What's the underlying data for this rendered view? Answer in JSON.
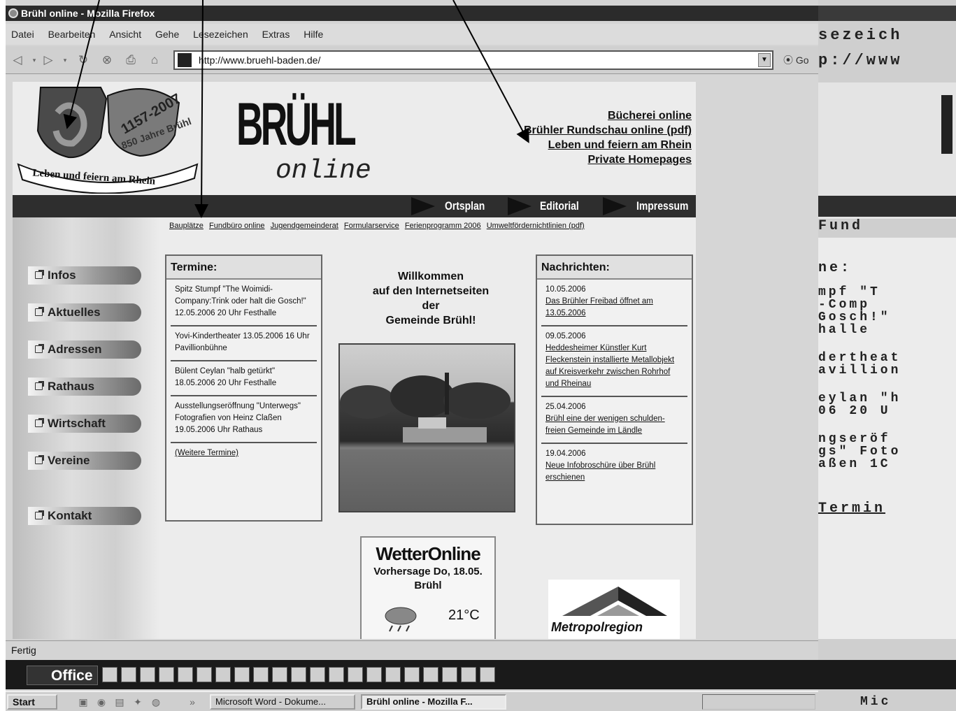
{
  "window": {
    "title": "Brühl online - Mozilla Firefox"
  },
  "menu": [
    "Datei",
    "Bearbeiten",
    "Ansicht",
    "Gehe",
    "Lesezeichen",
    "Extras",
    "Hilfe"
  ],
  "toolbar": {
    "url": "http://www.bruehl-baden.de/",
    "go_label": "Go"
  },
  "page": {
    "logo_motto": "Leben und feiern am Rhein",
    "logo_years": "1157-2007",
    "logo_jubilee": "850 Jahre Brühl",
    "brand_main": "BRÜHL",
    "brand_sub": "online",
    "top_links": [
      "Bücherei online",
      "Brühler Rundschau online (pdf)",
      "Leben und feiern am Rhein",
      "Private Homepages"
    ],
    "nav": [
      "Ortsplan",
      "Editorial",
      "Impressum"
    ],
    "sub_links": [
      "Bauplätze",
      "Fundbüro online",
      "Jugendgemeinderat",
      "Formularservice",
      "Ferienprogramm 2006",
      "Umweltfördernichtlinien (pdf)"
    ],
    "left_nav": [
      "Infos",
      "Aktuelles",
      "Adressen",
      "Rathaus",
      "Wirtschaft",
      "Vereine",
      "Kontakt"
    ],
    "termine": {
      "title": "Termine:",
      "items": [
        "Spitz Stumpf \"The Woimidi-Company:Trink oder halt die Gosch!\" 12.05.2006 20 Uhr Festhalle",
        "Yovi-Kindertheater 13.05.2006 16 Uhr Pavillionbühne",
        "Bülent Ceylan \"halb getürkt\" 18.05.2006 20 Uhr Festhalle",
        "Ausstellungseröffnung \"Unterwegs\" Fotografien von Heinz Claßen 19.05.2006 Uhr Rathaus"
      ],
      "more": "(Weitere Termine)"
    },
    "welcome": [
      "Willkommen",
      "auf den Internetseiten",
      "der",
      "Gemeinde Brühl!"
    ],
    "nachrichten": {
      "title": "Nachrichten:",
      "items": [
        {
          "date": "10.05.2006",
          "text": "Das Brühler Freibad öffnet am 13.05.2006"
        },
        {
          "date": "09.05.2006",
          "text": "Heddesheimer Künstler Kurt Fleckenstein installierte Metallobjekt auf Kreisverkehr zwischen Rohrhof und Rheinau"
        },
        {
          "date": "25.04.2006",
          "text": "Brühl eine der wenigen schulden-freien Gemeinde im Ländle"
        },
        {
          "date": "19.04.2006",
          "text": "Neue Infobroschüre über Brühl erschienen"
        }
      ]
    },
    "weather": {
      "brand": "WetterOnline",
      "forecast": "Vorhersage Do, 18.05.",
      "place": "Brühl",
      "temp": "21°C"
    },
    "metro": {
      "text": "Metropolregion"
    }
  },
  "status": {
    "text": "Fertig"
  },
  "officebar": {
    "label": "Office"
  },
  "taskbar": {
    "start": "Start",
    "tasks": [
      "Microsoft Word - Dokume...",
      "Brühl online - Mozilla F..."
    ]
  },
  "zoom_overlay": {
    "rows": [
      "sezeich",
      "p://www",
      "Fund",
      "ne:",
      "mpf \"T",
      "-Comp",
      "Gosch!\"",
      "halle",
      "dertheat",
      "avillion",
      "eylan \"h",
      "06 20 U",
      "ngseröf",
      "gs\" Foto",
      "aßen 1C",
      "Termin",
      "Mic"
    ]
  },
  "colors": {
    "navbar": "#2e2e2e",
    "titlebar": "#2b2b2b"
  }
}
